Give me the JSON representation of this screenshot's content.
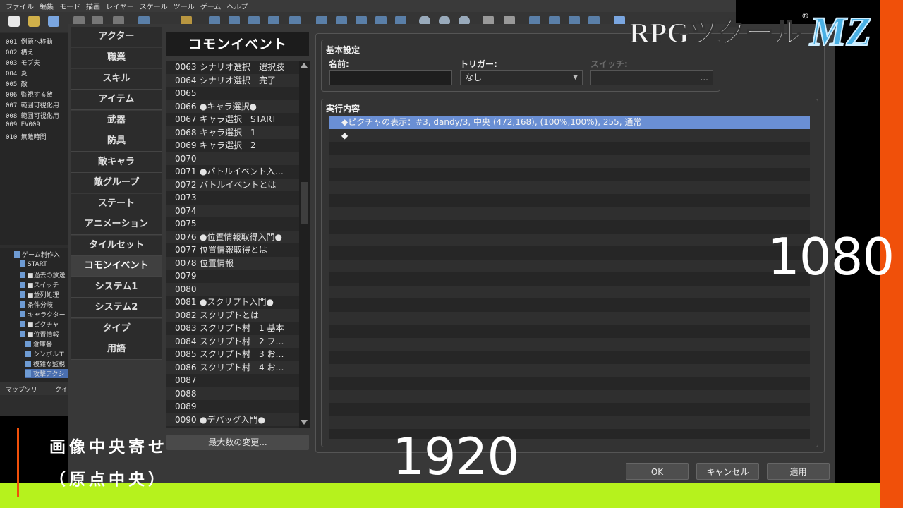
{
  "menubar": [
    "ファイル",
    "編集",
    "モード",
    "描画",
    "レイヤー",
    "スケール",
    "ツール",
    "ゲーム",
    "ヘルプ"
  ],
  "map_list": [
    "001 例題へ移動",
    "002 構え",
    "003 モブ夫",
    "004 炎",
    "005 敵",
    "006 監視する敵",
    "007 範囲可視化用",
    "008 範囲可視化用",
    "009 EV009",
    "010 無敵時間"
  ],
  "map_tree": [
    "ゲーム制作入",
    "START",
    "■過去の放送",
    "■スイッチ",
    "■並列処理",
    "条件分岐",
    "キャラクター",
    "■ピクチャ",
    "■位置情報",
    "倉庫番",
    "シンボルエ",
    "複雑な監視",
    "攻撃アクシ"
  ],
  "map_tabs": [
    "マップツリー",
    "クイ"
  ],
  "categories": [
    "アクター",
    "職業",
    "スキル",
    "アイテム",
    "武器",
    "防具",
    "敵キャラ",
    "敵グループ",
    "ステート",
    "アニメーション",
    "タイルセット",
    "コモンイベント",
    "システム1",
    "システム2",
    "タイプ",
    "用語"
  ],
  "active_category": "コモンイベント",
  "list_title": "コモンイベント",
  "events": [
    {
      "num": "0063",
      "name": "シナリオ選択　選択肢"
    },
    {
      "num": "0064",
      "name": "シナリオ選択　完了"
    },
    {
      "num": "0065",
      "name": ""
    },
    {
      "num": "0066",
      "name": "●キャラ選択●"
    },
    {
      "num": "0067",
      "name": "キャラ選択　START"
    },
    {
      "num": "0068",
      "name": "キャラ選択　1"
    },
    {
      "num": "0069",
      "name": "キャラ選択　2"
    },
    {
      "num": "0070",
      "name": ""
    },
    {
      "num": "0071",
      "name": "●バトルイベント入…"
    },
    {
      "num": "0072",
      "name": "バトルイベントとは"
    },
    {
      "num": "0073",
      "name": ""
    },
    {
      "num": "0074",
      "name": ""
    },
    {
      "num": "0075",
      "name": ""
    },
    {
      "num": "0076",
      "name": "●位置情報取得入門●"
    },
    {
      "num": "0077",
      "name": "位置情報取得とは"
    },
    {
      "num": "0078",
      "name": "位置情報"
    },
    {
      "num": "0079",
      "name": ""
    },
    {
      "num": "0080",
      "name": ""
    },
    {
      "num": "0081",
      "name": "●スクリプト入門●"
    },
    {
      "num": "0082",
      "name": "スクリプトとは"
    },
    {
      "num": "0083",
      "name": "スクリプト村　1 基本"
    },
    {
      "num": "0084",
      "name": "スクリプト村　2 フ…"
    },
    {
      "num": "0085",
      "name": "スクリプト村　3 お…"
    },
    {
      "num": "0086",
      "name": "スクリプト村　4 お…"
    },
    {
      "num": "0087",
      "name": ""
    },
    {
      "num": "0088",
      "name": ""
    },
    {
      "num": "0089",
      "name": ""
    },
    {
      "num": "0090",
      "name": "●デバッグ入門●"
    }
  ],
  "max_button": "最大数の変更...",
  "basic": {
    "group_label": "基本設定",
    "name_label": "名前:",
    "name_value": "",
    "trigger_label": "トリガー:",
    "trigger_value": "なし",
    "switch_label": "スイッチ:",
    "switch_value": "..."
  },
  "content": {
    "label": "実行内容",
    "commands": [
      "◆ピクチャの表示：#3, dandy/3, 中央 (472,168), (100%,100%), 255, 通常",
      "◆"
    ]
  },
  "buttons": {
    "ok": "OK",
    "cancel": "キャンセル",
    "apply": "適用"
  },
  "overlay": {
    "logo_text": "RPGツクール",
    "logo_mz": "MZ",
    "logo_reg": "®",
    "height_label": "1080",
    "width_label": "1920",
    "caption_line1": "画像中央寄せ",
    "caption_line2": "（原点中央）",
    "accent_orange": "#f0500a",
    "accent_green": "#b6f21d"
  }
}
